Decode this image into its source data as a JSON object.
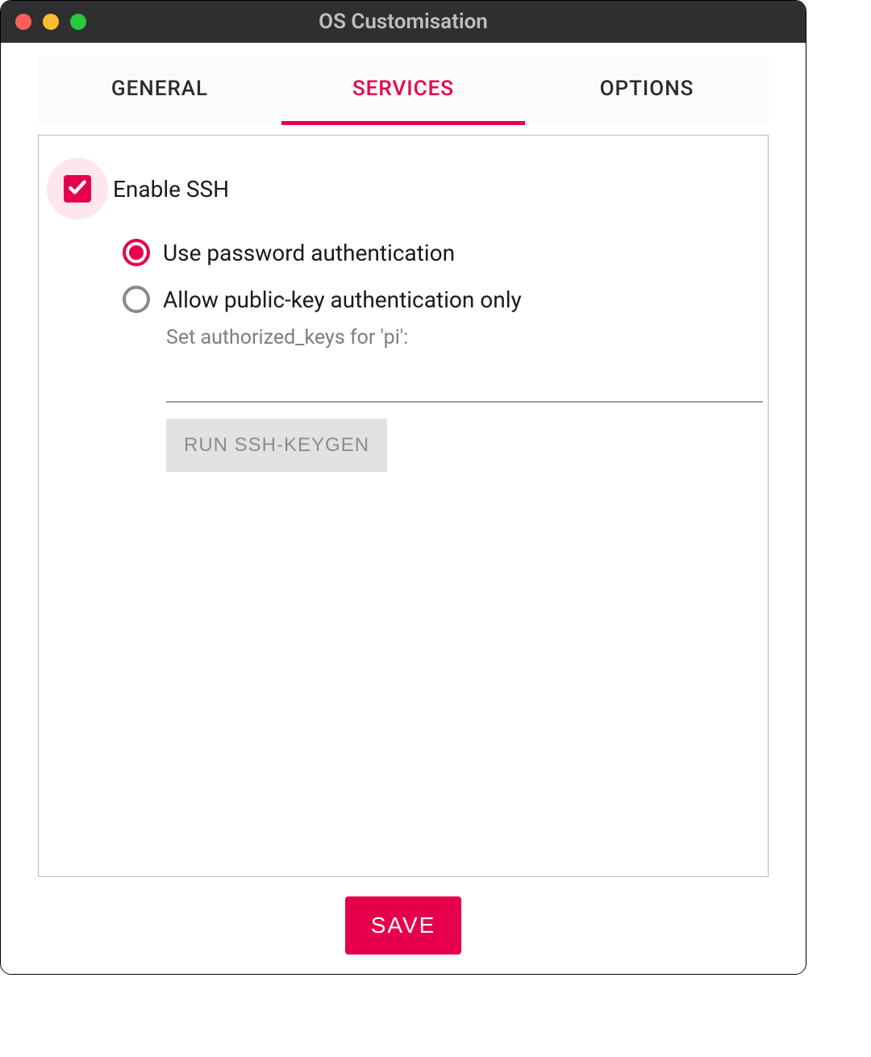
{
  "window": {
    "title": "OS Customisation"
  },
  "tabs": {
    "general": "GENERAL",
    "services": "SERVICES",
    "options": "OPTIONS"
  },
  "ssh": {
    "enable_label": "Enable SSH",
    "password_auth_label": "Use password authentication",
    "pubkey_auth_label": "Allow public-key authentication only",
    "authorized_keys_hint": "Set authorized_keys for 'pi':",
    "authorized_keys_value": "",
    "keygen_button": "RUN SSH-KEYGEN"
  },
  "footer": {
    "save_label": "SAVE"
  }
}
